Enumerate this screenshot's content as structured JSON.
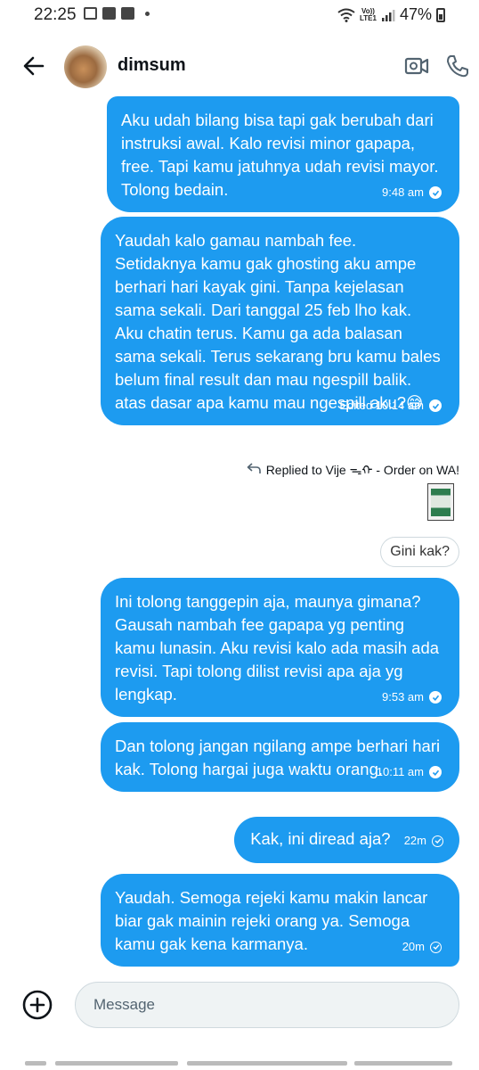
{
  "status_bar": {
    "time": "22:25",
    "battery": "47%",
    "network_label": "LTE1",
    "volte_label": "Vo))"
  },
  "header": {
    "contact_name": "dimsum",
    "icons": [
      "back-arrow-icon",
      "video-call-icon",
      "phone-icon"
    ]
  },
  "messages": [
    {
      "text": "Aku udah bilang bisa tapi gak berubah dari instruksi awal. Kalo revisi minor gapapa, free. Tapi kamu jatuhnya udah revisi mayor. Tolong bedain.",
      "time": "9:48 am",
      "status": "sent-filled"
    },
    {
      "text": "Yaudah kalo gamau nambah fee. Setidaknya kamu gak ghosting aku ampe berhari hari kayak gini. Tanpa kejelasan sama sekali. Dari tanggal 25 feb lho kak. Aku chatin terus. Kamu ga ada balasan sama sekali. Terus sekarang bru kamu bales belum final result dan mau ngespill balik. atas dasar apa kamu mau ngespill aku?😅",
      "time": "Edited 10:14 am",
      "status": "sent-filled"
    },
    {
      "text": "Ini tolong tanggepin aja, maunya gimana? Gausah nambah fee gapapa yg penting kamu lunasin. Aku revisi kalo ada masih ada revisi. Tapi tolong dilist revisi apa aja yg lengkap.",
      "time": "9:53 am",
      "status": "sent-filled"
    },
    {
      "text": "Dan tolong jangan ngilang ampe berhari hari kak. Tolong hargai juga waktu orang.",
      "time": "10:11 am",
      "status": "sent-filled"
    },
    {
      "text": "Kak, ini diread aja?",
      "time": "22m",
      "status": "sent-outline"
    },
    {
      "text": "Yaudah. Semoga rejeki kamu makin lancar biar gak mainin rejeki orang ya. Semoga kamu gak kena karmanya.",
      "time": "20m",
      "status": "sent-outline"
    }
  ],
  "reply": {
    "label": "Replied to Vije ᯓᡣ - Order on WA!",
    "quoted_text": "Gini kak?"
  },
  "composer": {
    "placeholder": "Message"
  },
  "colors": {
    "bubble": "#1d9bf0",
    "bubble_text": "#ffffff",
    "composer_bg": "#eff3f4"
  }
}
